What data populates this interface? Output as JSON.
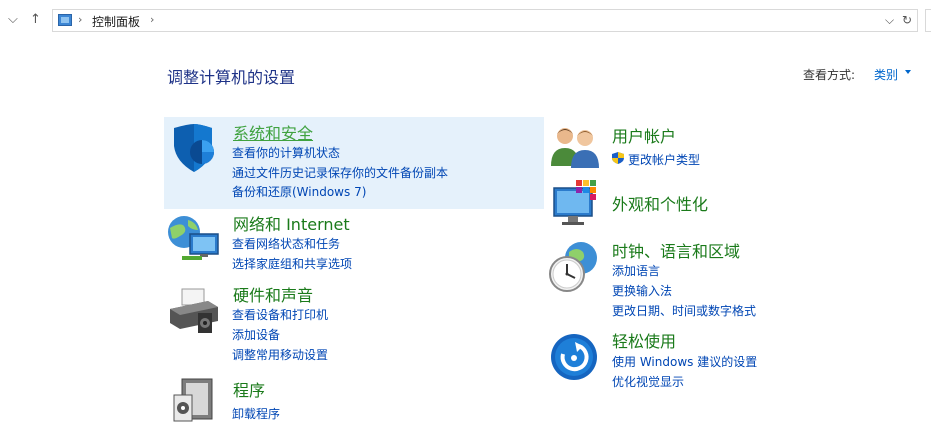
{
  "address_bar": {
    "crumb": "控制面板"
  },
  "header": {
    "title": "调整计算机的设置",
    "view_by_label": "查看方式:",
    "view_by_value": "类别"
  },
  "categories_left": [
    {
      "title": "系统和安全",
      "icon": "shield-icon",
      "links": [
        "查看你的计算机状态",
        "通过文件历史记录保存你的文件备份副本",
        "备份和还原(Windows 7)"
      ]
    },
    {
      "title": "网络和 Internet",
      "icon": "network-globe-icon",
      "links": [
        "查看网络状态和任务",
        "选择家庭组和共享选项"
      ]
    },
    {
      "title": "硬件和声音",
      "icon": "printer-icon",
      "links": [
        "查看设备和打印机",
        "添加设备",
        "调整常用移动设置"
      ]
    },
    {
      "title": "程序",
      "icon": "programs-icon",
      "links": [
        "卸载程序"
      ]
    }
  ],
  "categories_right": [
    {
      "title": "用户帐户",
      "icon": "user-accounts-icon",
      "links": [
        "更改帐户类型"
      ]
    },
    {
      "title": "外观和个性化",
      "icon": "appearance-icon",
      "links": []
    },
    {
      "title": "时钟、语言和区域",
      "icon": "clock-globe-icon",
      "links": [
        "添加语言",
        "更换输入法",
        "更改日期、时间或数字格式"
      ]
    },
    {
      "title": "轻松使用",
      "icon": "ease-of-access-icon",
      "links": [
        "使用 Windows 建议的设置",
        "优化视觉显示"
      ]
    }
  ]
}
